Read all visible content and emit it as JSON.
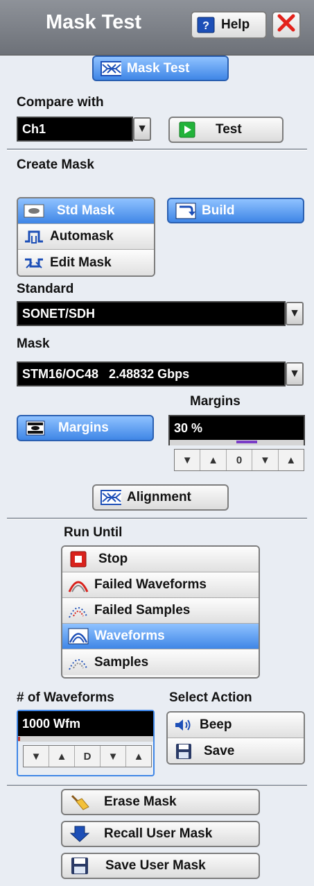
{
  "title": "Mask Test",
  "help_label": "Help",
  "mask_test_button": "Mask Test",
  "compare_with": {
    "label": "Compare with",
    "value": "Ch1",
    "test_button": "Test"
  },
  "create_mask": {
    "label": "Create Mask",
    "modes": [
      "Std Mask",
      "Automask",
      "Edit Mask"
    ],
    "selected": "Std Mask",
    "build_button": "Build"
  },
  "standard": {
    "label": "Standard",
    "value": "SONET/SDH"
  },
  "mask": {
    "label": "Mask",
    "value": "STM16/OC48   2.48832 Gbps"
  },
  "margins": {
    "button": "Margins",
    "label": "Margins",
    "value": "30 %",
    "stepper": [
      "▼",
      "▲",
      "0",
      "▼",
      "▲"
    ]
  },
  "alignment_button": "Alignment",
  "run_until": {
    "label": "Run Until",
    "options": [
      "Stop",
      "Failed Waveforms",
      "Failed Samples",
      "Waveforms",
      "Samples"
    ],
    "selected": "Waveforms"
  },
  "waveforms": {
    "label": "# of Waveforms",
    "value": "1000 Wfm",
    "stepper": [
      "▼",
      "▲",
      "D",
      "▼",
      "▲"
    ]
  },
  "select_action": {
    "label": "Select Action",
    "options": [
      "Beep",
      "Save"
    ]
  },
  "bottom": {
    "erase": "Erase Mask",
    "recall": "Recall User Mask",
    "save": "Save User Mask"
  },
  "colors": {
    "accent": "#3f86e6",
    "titlebar": "#7d8188",
    "stop_red": "#d9221c",
    "test_green": "#22b33a"
  }
}
